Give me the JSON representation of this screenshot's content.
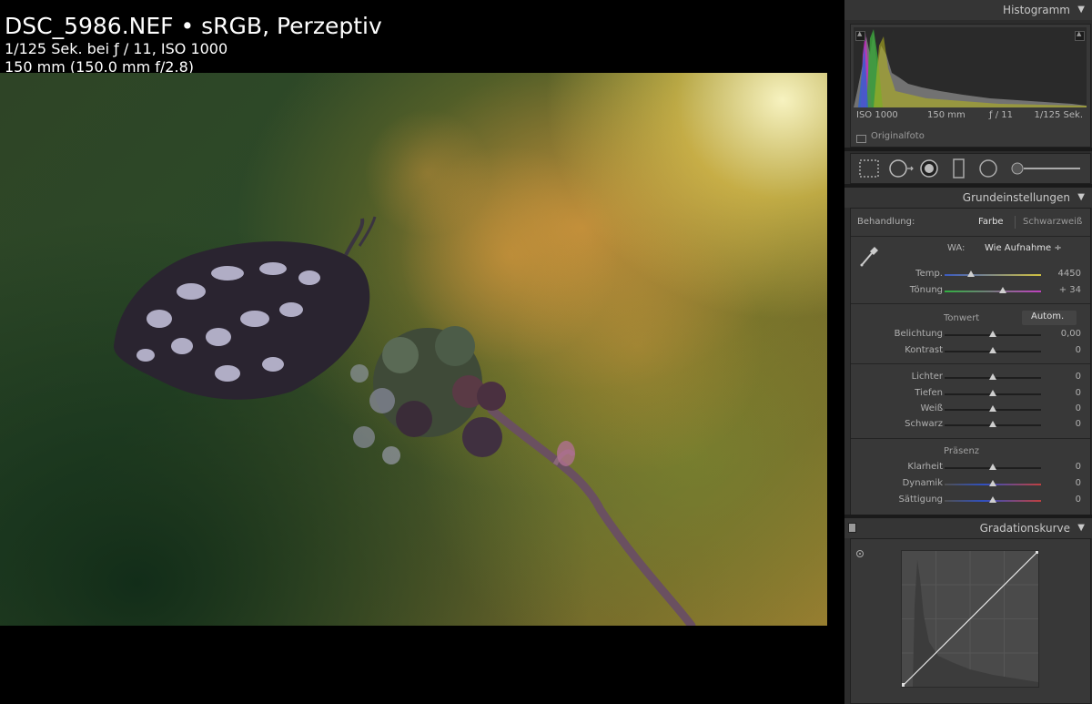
{
  "info": {
    "line1": "DSC_5986.NEF  •  sRGB, Perzeptiv",
    "line2": "1/125 Sek. bei ƒ / 11, ISO 1000",
    "line3": "150 mm (150.0 mm f/2.8)"
  },
  "panel": {
    "histogram": {
      "title": "Histogramm",
      "iso": "ISO 1000",
      "focal": "150 mm",
      "aperture": "ƒ / 11",
      "shutter": "1/125 Sek.",
      "original_label": "Originalfoto"
    },
    "basic": {
      "title": "Grundeinstellungen",
      "treatment_label": "Behandlung:",
      "treatment_color": "Farbe",
      "treatment_bw": "Schwarzweiß",
      "wb_label": "WA:",
      "wb_value": "Wie Aufnahme ÷",
      "temp_label": "Temp.",
      "temp_value": "4450",
      "tint_label": "Tönung",
      "tint_value": "+ 34",
      "tone_label": "Tonwert",
      "auto_label": "Autom.",
      "exposure_label": "Belichtung",
      "exposure_value": "0,00",
      "contrast_label": "Kontrast",
      "contrast_value": "0",
      "highlights_label": "Lichter",
      "highlights_value": "0",
      "shadows_label": "Tiefen",
      "shadows_value": "0",
      "whites_label": "Weiß",
      "whites_value": "0",
      "blacks_label": "Schwarz",
      "blacks_value": "0",
      "presence_label": "Präsenz",
      "clarity_label": "Klarheit",
      "clarity_value": "0",
      "vibrance_label": "Dynamik",
      "vibrance_value": "0",
      "saturation_label": "Sättigung",
      "saturation_value": "0"
    },
    "curve": {
      "title": "Gradationskurve"
    }
  },
  "icons": [
    "collapse-triangle-icon",
    "crop-icon",
    "spot-removal-icon",
    "red-eye-icon",
    "graduated-filter-icon",
    "radial-filter-icon",
    "adjustment-brush-icon",
    "eyedropper-icon",
    "target-adjust-icon"
  ]
}
